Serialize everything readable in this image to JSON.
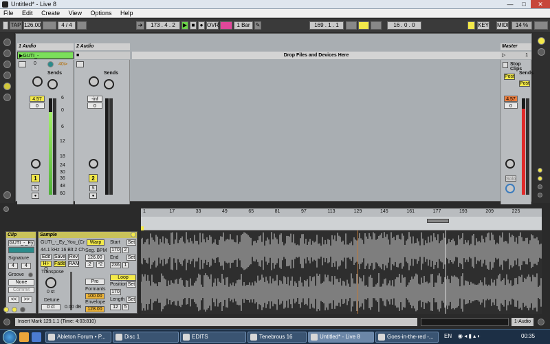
{
  "window": {
    "title": "Untitled* - Live 8",
    "minimize": "—",
    "maximize": "□",
    "close": "✕"
  },
  "menu": [
    "File",
    "Edit",
    "Create",
    "View",
    "Options",
    "Help"
  ],
  "transport": {
    "tap": "TAP",
    "tempo": "126.00",
    "time_sig": "4 / 4",
    "position": "173 . 4 . 2",
    "ovr": "OVR",
    "quantize": "1 Bar",
    "loop_start": "169 . 1 . 1",
    "loop_length": "16 . 0 . 0",
    "key": "KEY",
    "midi": "MIDI",
    "cpu": "14 %"
  },
  "session": {
    "tracks": [
      {
        "name": "1 Audio",
        "clip": "GUTI_-_Ey_You_(Corre",
        "send_label": "Sends",
        "volume": "4.57",
        "pan": "0",
        "number": "1",
        "solo": "S"
      },
      {
        "name": "2 Audio",
        "clip": "",
        "send_label": "Sends",
        "volume": "-inf",
        "pan": "0",
        "number": "2",
        "solo": "S"
      }
    ],
    "drop_text": "Drop Files and Devices Here",
    "master": {
      "name": "Master",
      "slot": "1",
      "stop_clips": "Stop Clips",
      "send_label": "Sends",
      "post1": "Post",
      "post2": "Post",
      "volume": "4.57",
      "pan": "0",
      "cue": "Solo"
    },
    "track1_row": {
      "left": "0",
      "right": "40⊳"
    },
    "scale": [
      "6",
      "0",
      "6",
      "12",
      "18",
      "24",
      "30",
      "36",
      "48",
      "60"
    ]
  },
  "clip_view": {
    "clip_title": "Clip",
    "clip_name": "GUTI_-_Ey",
    "signature_label": "Signature",
    "sig_num": "4",
    "sig_den": "4",
    "groove_label": "Groove",
    "groove_value": "None",
    "commit": "Commit",
    "nav_left": "<<",
    "nav_right": ">>"
  },
  "sample": {
    "title": "Sample",
    "name": "GUTI_-_Ey_You_(Cr",
    "info": "44.1 kHz 16 Bit 2 Ch",
    "warp": "Warp",
    "edit": "Edit",
    "save": "Save",
    "rev": "Rev",
    "hiq": "Hi-Q",
    "fade": "Fade",
    "ram": "RAM",
    "seg_bpm_label": "Seg. BPM",
    "seg_bpm": "126.00",
    "half": ":2",
    "double": "*2",
    "transpose_label": "Transpose",
    "transpose_value": "0 st",
    "detune_label": "Detune",
    "detune_value": "0 ct",
    "gain_value": "0.00 dB",
    "warp_mode": "Pro",
    "formants_label": "Formants",
    "formants_value": "100.00",
    "envelope_label": "Envelope",
    "envelope_value": "128.00",
    "start_label": "Start",
    "start_value": "170",
    "start_beat": "2",
    "end_label": "End",
    "end_value": "236",
    "end_beat": "1",
    "set": "Set",
    "loop": "Loop",
    "position_label": "Position",
    "position_value": "170",
    "length_label": "Length",
    "length_value": "12",
    "length_beat": "5"
  },
  "ruler_ticks": [
    "1",
    "17",
    "33",
    "49",
    "65",
    "81",
    "97",
    "113",
    "129",
    "145",
    "161",
    "177",
    "193",
    "209",
    "225"
  ],
  "status": {
    "message": "Insert Mark 129.1.1 (Time: 4:03:810)",
    "track_label": "1-Audio"
  },
  "taskbar": {
    "items": [
      "Ableton Forum • P...",
      "Disc 1",
      "EDITS",
      "Tenebrous 16",
      "Untitled* - Live 8",
      "Goes-in-the-red -..."
    ],
    "lang": "EN",
    "clock": "00:35"
  },
  "colors": {
    "accent_yellow": "#f3e94a",
    "ovr_pink": "#e0479a",
    "meter_green": "#6cd34a",
    "meter_red": "#e02a2a",
    "session_bg": "#a9aeb2"
  }
}
